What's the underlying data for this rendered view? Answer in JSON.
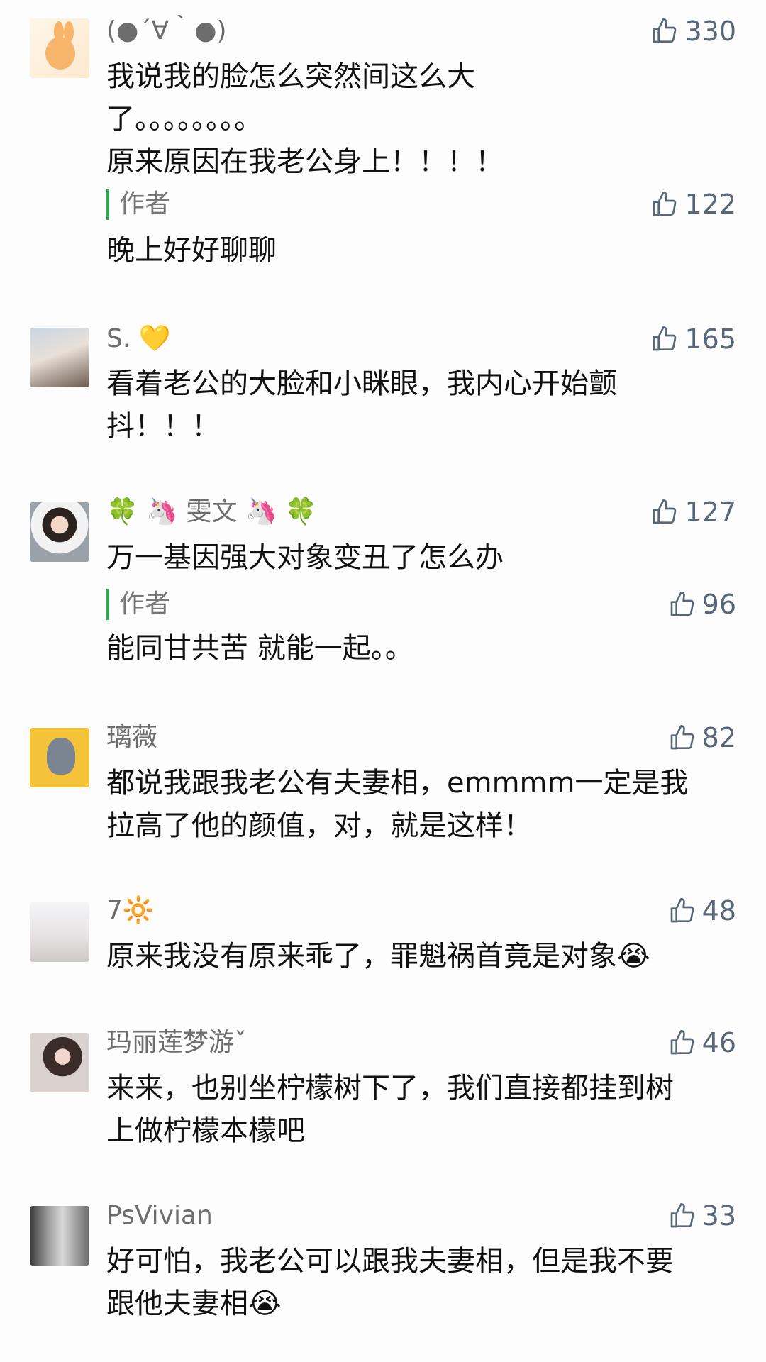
{
  "comments": [
    {
      "username": "(●´∀｀●)",
      "likes": "330",
      "text": "我说我的脸怎么突然间这么大\n了。。。。。。。。\n原来原因在我老公身上！！！！",
      "avatar_icon": "bunny-avatar",
      "author_reply": {
        "label": "作者",
        "likes": "122",
        "text": "晚上好好聊聊"
      }
    },
    {
      "username": "S. 💛",
      "likes": "165",
      "text": "看着老公的大脸和小眯眼，我内心开始颤\n抖！！！",
      "avatar_icon": "photo-avatar"
    },
    {
      "username": "🍀 🦄 雯文 🦄 🍀",
      "likes": "127",
      "text": "万一基因强大对象变丑了怎么办",
      "avatar_icon": "photo-avatar",
      "author_reply": {
        "label": "作者",
        "likes": "96",
        "text": "能同甘共苦 就能一起。。"
      }
    },
    {
      "username": "璃薇",
      "likes": "82",
      "text": "都说我跟我老公有夫妻相，emmmm一定是我\n拉高了他的颜值，对，就是这样！",
      "avatar_icon": "totoro-avatar"
    },
    {
      "username": "7🔆",
      "likes": "48",
      "text": "原来我没有原来乖了，罪魁祸首竟是对象😭",
      "avatar_icon": "photo-avatar"
    },
    {
      "username": "玛丽莲梦游ˇ",
      "likes": "46",
      "text": "来来，也别坐柠檬树下了，我们直接都挂到树\n上做柠檬本檬吧",
      "avatar_icon": "photo-avatar"
    },
    {
      "username": "PsVivian",
      "likes": "33",
      "text": "好可怕，我老公可以跟我夫妻相，但是我不要\n跟他夫妻相😭",
      "avatar_icon": "photo-avatar"
    }
  ],
  "colors": {
    "author_bar": "#2fa84f",
    "like_icon": "#596878",
    "username": "#6d6d6d"
  }
}
